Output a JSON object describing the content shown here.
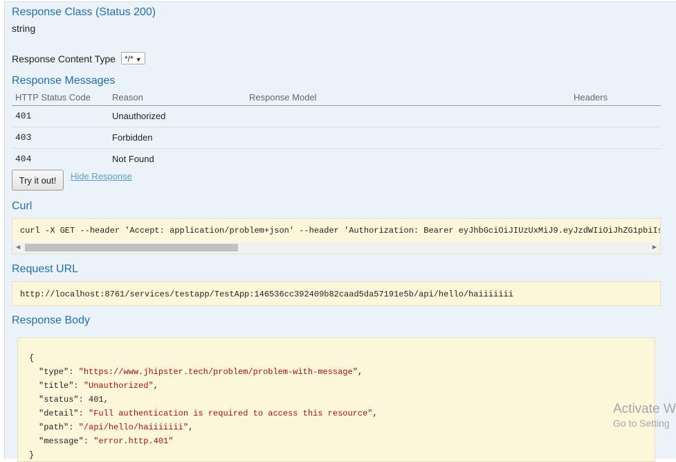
{
  "response_class": {
    "title": "Response Class (Status 200)",
    "type": "string"
  },
  "content_type": {
    "label": "Response Content Type",
    "selected": "*/*"
  },
  "response_messages": {
    "title": "Response Messages",
    "columns": [
      "HTTP Status Code",
      "Reason",
      "Response Model",
      "Headers"
    ],
    "rows": [
      {
        "code": "401",
        "reason": "Unauthorized"
      },
      {
        "code": "403",
        "reason": "Forbidden"
      },
      {
        "code": "404",
        "reason": "Not Found"
      }
    ]
  },
  "actions": {
    "try_button": "Try it out!",
    "hide_link": "Hide Response"
  },
  "curl": {
    "title": "Curl",
    "command": "curl -X GET --header 'Accept: application/problem+json' --header 'Authorization: Bearer eyJhbGciOiJIUzUxMiJ9.eyJzdWIiOiJhZG1pbiIsI"
  },
  "request_url": {
    "title": "Request URL",
    "url": "http://localhost:8761/services/testapp/TestApp:146536cc392409b82caad5da57191e5b/api/hello/haiiiiiii"
  },
  "response_body": {
    "title": "Response Body",
    "open_brace": "{",
    "fields": [
      {
        "key": "\"type\"",
        "value": "\"https://www.jhipster.tech/problem/problem-with-message\"",
        "kind": "str",
        "comma": ","
      },
      {
        "key": "\"title\"",
        "value": "\"Unauthorized\"",
        "kind": "str",
        "comma": ","
      },
      {
        "key": "\"status\"",
        "value": "401",
        "kind": "num",
        "comma": ","
      },
      {
        "key": "\"detail\"",
        "value": "\"Full authentication is required to access this resource\"",
        "kind": "str",
        "comma": ","
      },
      {
        "key": "\"path\"",
        "value": "\"/api/hello/haiiiiiii\"",
        "kind": "str",
        "comma": ","
      },
      {
        "key": "\"message\"",
        "value": "\"error.http.401\"",
        "kind": "str",
        "comma": ""
      }
    ],
    "close_brace": "}"
  },
  "watermark": {
    "line1": "Activate W",
    "line2": "Go to Setting"
  }
}
